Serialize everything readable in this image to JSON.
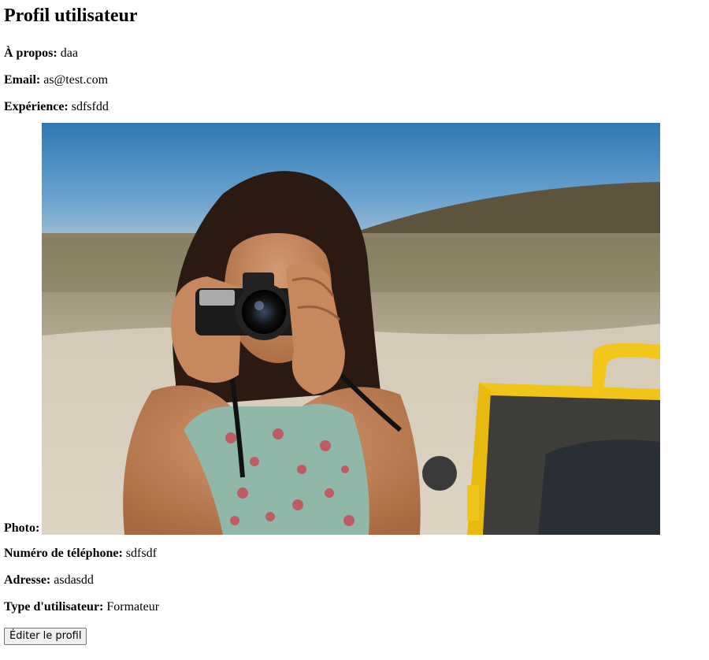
{
  "page": {
    "title": "Profil utilisateur"
  },
  "profile": {
    "about_label": "À propos:",
    "about_value": "daa",
    "email_label": "Email:",
    "email_value": "as@test.com",
    "experience_label": "Expérience:",
    "experience_value": "sdfsfdd",
    "photo_label": "Photo:",
    "photo_description": "photo-of-woman-with-camera",
    "phone_label": "Numéro de téléphone:",
    "phone_value": "sdfsdf",
    "address_label": "Adresse:",
    "address_value": "asdasdd",
    "user_type_label": "Type d'utilisateur:",
    "user_type_value": "Formateur"
  },
  "actions": {
    "edit_label": "Éditer le profil"
  },
  "colors": {
    "sky": "#3f86bd",
    "hill": "#5f5640",
    "sand": "#d7cfc0",
    "buggy": "#f1c40f"
  }
}
